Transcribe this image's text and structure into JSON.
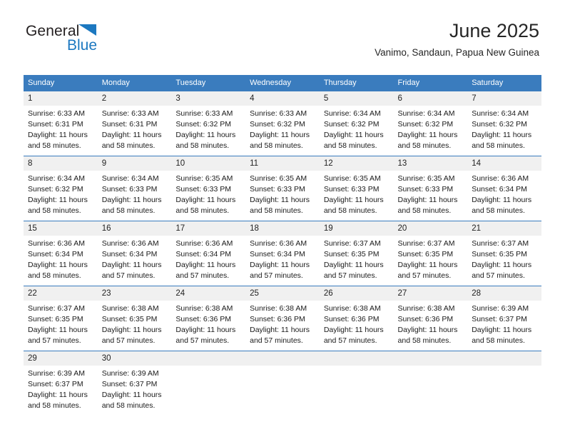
{
  "brand": {
    "name_part1": "General",
    "name_part2": "Blue",
    "accent_color": "#1c78c0",
    "triangle_icon": "brand-triangle-icon"
  },
  "header": {
    "title": "June 2025",
    "subtitle": "Vanimo, Sandaun, Papua New Guinea"
  },
  "colors": {
    "header_row_bg": "#3a7cbe",
    "daynum_bg": "#f0f0f0",
    "text": "#1a1a1a"
  },
  "weekdays": [
    "Sunday",
    "Monday",
    "Tuesday",
    "Wednesday",
    "Thursday",
    "Friday",
    "Saturday"
  ],
  "weeks": [
    [
      {
        "day": "1",
        "sunrise": "Sunrise: 6:33 AM",
        "sunset": "Sunset: 6:31 PM",
        "daylight": "Daylight: 11 hours and 58 minutes."
      },
      {
        "day": "2",
        "sunrise": "Sunrise: 6:33 AM",
        "sunset": "Sunset: 6:31 PM",
        "daylight": "Daylight: 11 hours and 58 minutes."
      },
      {
        "day": "3",
        "sunrise": "Sunrise: 6:33 AM",
        "sunset": "Sunset: 6:32 PM",
        "daylight": "Daylight: 11 hours and 58 minutes."
      },
      {
        "day": "4",
        "sunrise": "Sunrise: 6:33 AM",
        "sunset": "Sunset: 6:32 PM",
        "daylight": "Daylight: 11 hours and 58 minutes."
      },
      {
        "day": "5",
        "sunrise": "Sunrise: 6:34 AM",
        "sunset": "Sunset: 6:32 PM",
        "daylight": "Daylight: 11 hours and 58 minutes."
      },
      {
        "day": "6",
        "sunrise": "Sunrise: 6:34 AM",
        "sunset": "Sunset: 6:32 PM",
        "daylight": "Daylight: 11 hours and 58 minutes."
      },
      {
        "day": "7",
        "sunrise": "Sunrise: 6:34 AM",
        "sunset": "Sunset: 6:32 PM",
        "daylight": "Daylight: 11 hours and 58 minutes."
      }
    ],
    [
      {
        "day": "8",
        "sunrise": "Sunrise: 6:34 AM",
        "sunset": "Sunset: 6:32 PM",
        "daylight": "Daylight: 11 hours and 58 minutes."
      },
      {
        "day": "9",
        "sunrise": "Sunrise: 6:34 AM",
        "sunset": "Sunset: 6:33 PM",
        "daylight": "Daylight: 11 hours and 58 minutes."
      },
      {
        "day": "10",
        "sunrise": "Sunrise: 6:35 AM",
        "sunset": "Sunset: 6:33 PM",
        "daylight": "Daylight: 11 hours and 58 minutes."
      },
      {
        "day": "11",
        "sunrise": "Sunrise: 6:35 AM",
        "sunset": "Sunset: 6:33 PM",
        "daylight": "Daylight: 11 hours and 58 minutes."
      },
      {
        "day": "12",
        "sunrise": "Sunrise: 6:35 AM",
        "sunset": "Sunset: 6:33 PM",
        "daylight": "Daylight: 11 hours and 58 minutes."
      },
      {
        "day": "13",
        "sunrise": "Sunrise: 6:35 AM",
        "sunset": "Sunset: 6:33 PM",
        "daylight": "Daylight: 11 hours and 58 minutes."
      },
      {
        "day": "14",
        "sunrise": "Sunrise: 6:36 AM",
        "sunset": "Sunset: 6:34 PM",
        "daylight": "Daylight: 11 hours and 58 minutes."
      }
    ],
    [
      {
        "day": "15",
        "sunrise": "Sunrise: 6:36 AM",
        "sunset": "Sunset: 6:34 PM",
        "daylight": "Daylight: 11 hours and 58 minutes."
      },
      {
        "day": "16",
        "sunrise": "Sunrise: 6:36 AM",
        "sunset": "Sunset: 6:34 PM",
        "daylight": "Daylight: 11 hours and 57 minutes."
      },
      {
        "day": "17",
        "sunrise": "Sunrise: 6:36 AM",
        "sunset": "Sunset: 6:34 PM",
        "daylight": "Daylight: 11 hours and 57 minutes."
      },
      {
        "day": "18",
        "sunrise": "Sunrise: 6:36 AM",
        "sunset": "Sunset: 6:34 PM",
        "daylight": "Daylight: 11 hours and 57 minutes."
      },
      {
        "day": "19",
        "sunrise": "Sunrise: 6:37 AM",
        "sunset": "Sunset: 6:35 PM",
        "daylight": "Daylight: 11 hours and 57 minutes."
      },
      {
        "day": "20",
        "sunrise": "Sunrise: 6:37 AM",
        "sunset": "Sunset: 6:35 PM",
        "daylight": "Daylight: 11 hours and 57 minutes."
      },
      {
        "day": "21",
        "sunrise": "Sunrise: 6:37 AM",
        "sunset": "Sunset: 6:35 PM",
        "daylight": "Daylight: 11 hours and 57 minutes."
      }
    ],
    [
      {
        "day": "22",
        "sunrise": "Sunrise: 6:37 AM",
        "sunset": "Sunset: 6:35 PM",
        "daylight": "Daylight: 11 hours and 57 minutes."
      },
      {
        "day": "23",
        "sunrise": "Sunrise: 6:38 AM",
        "sunset": "Sunset: 6:35 PM",
        "daylight": "Daylight: 11 hours and 57 minutes."
      },
      {
        "day": "24",
        "sunrise": "Sunrise: 6:38 AM",
        "sunset": "Sunset: 6:36 PM",
        "daylight": "Daylight: 11 hours and 57 minutes."
      },
      {
        "day": "25",
        "sunrise": "Sunrise: 6:38 AM",
        "sunset": "Sunset: 6:36 PM",
        "daylight": "Daylight: 11 hours and 57 minutes."
      },
      {
        "day": "26",
        "sunrise": "Sunrise: 6:38 AM",
        "sunset": "Sunset: 6:36 PM",
        "daylight": "Daylight: 11 hours and 57 minutes."
      },
      {
        "day": "27",
        "sunrise": "Sunrise: 6:38 AM",
        "sunset": "Sunset: 6:36 PM",
        "daylight": "Daylight: 11 hours and 58 minutes."
      },
      {
        "day": "28",
        "sunrise": "Sunrise: 6:39 AM",
        "sunset": "Sunset: 6:37 PM",
        "daylight": "Daylight: 11 hours and 58 minutes."
      }
    ],
    [
      {
        "day": "29",
        "sunrise": "Sunrise: 6:39 AM",
        "sunset": "Sunset: 6:37 PM",
        "daylight": "Daylight: 11 hours and 58 minutes."
      },
      {
        "day": "30",
        "sunrise": "Sunrise: 6:39 AM",
        "sunset": "Sunset: 6:37 PM",
        "daylight": "Daylight: 11 hours and 58 minutes."
      },
      {
        "day": "",
        "sunrise": "",
        "sunset": "",
        "daylight": ""
      },
      {
        "day": "",
        "sunrise": "",
        "sunset": "",
        "daylight": ""
      },
      {
        "day": "",
        "sunrise": "",
        "sunset": "",
        "daylight": ""
      },
      {
        "day": "",
        "sunrise": "",
        "sunset": "",
        "daylight": ""
      },
      {
        "day": "",
        "sunrise": "",
        "sunset": "",
        "daylight": ""
      }
    ]
  ]
}
